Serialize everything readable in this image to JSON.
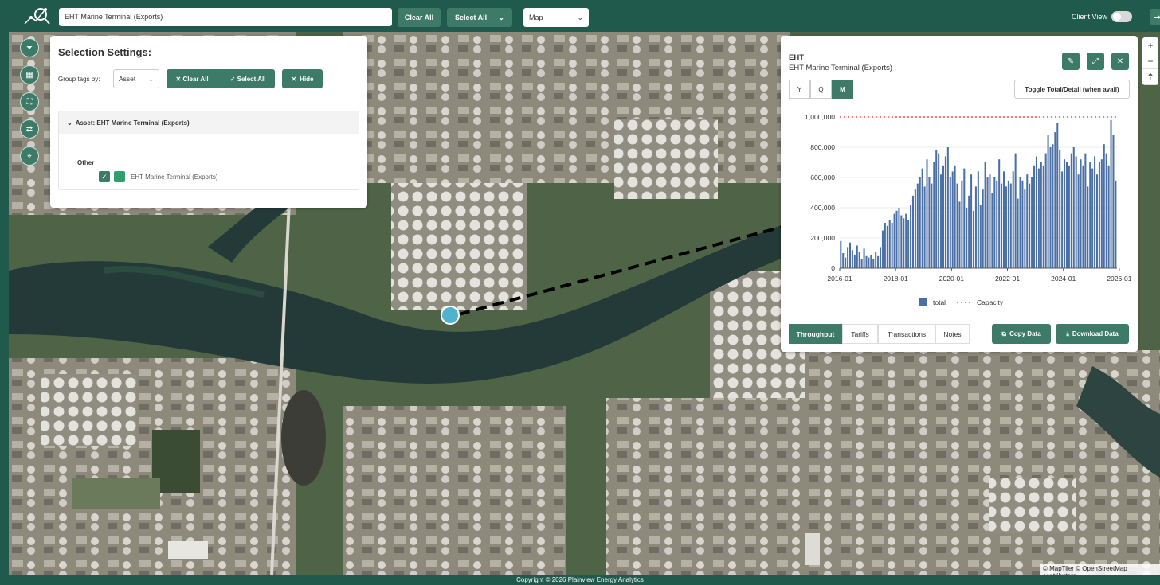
{
  "topbar": {
    "search_value": "EHT Marine Terminal (Exports)",
    "clear_all": "Clear All",
    "select_all": "Select All",
    "view_select": "Map",
    "client_view": "Client View"
  },
  "selection": {
    "title": "Selection Settings:",
    "group_by_label": "Group tags by:",
    "group_by_value": "Asset",
    "clear_all": "Clear All",
    "select_all": "Select All",
    "hide": "Hide",
    "asset_header": "Asset: EHT Marine Terminal (Exports)",
    "group": "Other",
    "item": "EHT Marine Terminal (Exports)"
  },
  "detail": {
    "code": "EHT",
    "name": "EHT Marine Terminal (Exports)",
    "toggle": "Toggle Total/Detail (when avail)",
    "periods": [
      "Y",
      "Q",
      "M"
    ],
    "tabs": [
      "Throughput",
      "Tariffs",
      "Transactions",
      "Notes"
    ],
    "copy": "Copy Data",
    "download": "Download Data"
  },
  "chart_data": {
    "type": "bar",
    "x_ticks": [
      "2016-01",
      "2018-01",
      "2020-01",
      "2022-01",
      "2024-01",
      "2026-01"
    ],
    "y_ticks": [
      "0",
      "200,000",
      "400,000",
      "600,000",
      "800,000",
      "1,000,000"
    ],
    "ylim": [
      0,
      1000000
    ],
    "legend": [
      "total",
      "Capacity"
    ],
    "capacity": 1000000,
    "series": [
      {
        "name": "total",
        "start": "2016-01",
        "values": [
          180000,
          100000,
          70000,
          140000,
          170000,
          120000,
          90000,
          150000,
          110000,
          60000,
          130000,
          80000,
          70000,
          90000,
          60000,
          110000,
          80000,
          140000,
          250000,
          300000,
          280000,
          320000,
          300000,
          360000,
          380000,
          400000,
          350000,
          330000,
          360000,
          320000,
          420000,
          480000,
          520000,
          560000,
          600000,
          660000,
          540000,
          720000,
          600000,
          560000,
          700000,
          780000,
          760000,
          620000,
          680000,
          740000,
          800000,
          600000,
          640000,
          680000,
          560000,
          440000,
          580000,
          660000,
          400000,
          480000,
          620000,
          380000,
          540000,
          640000,
          420000,
          520000,
          700000,
          600000,
          620000,
          500000,
          600000,
          580000,
          720000,
          560000,
          640000,
          540000,
          580000,
          560000,
          640000,
          760000,
          460000,
          600000,
          580000,
          520000,
          620000,
          560000,
          600000,
          680000,
          740000,
          660000,
          700000,
          680000,
          760000,
          880000,
          800000,
          820000,
          900000,
          960000,
          780000,
          640000,
          720000,
          700000,
          680000,
          760000,
          800000,
          740000,
          620000,
          720000,
          680000,
          760000,
          540000,
          700000,
          660000,
          740000,
          620000,
          700000,
          720000,
          820000,
          760000,
          680000,
          980000,
          880000,
          580000
        ]
      }
    ]
  },
  "footer": "Copyright © 2026 Plainview Energy Analytics",
  "attribution": "© MapTiler © OpenStreetMap contributors",
  "map_logo": "maptiler",
  "icons": [
    "filter-icon",
    "map-icon",
    "expand-icon",
    "swap-icon",
    "pin-icon",
    "edit-icon",
    "fullscreen-icon",
    "close-icon",
    "plus-icon",
    "minus-icon",
    "compass-icon"
  ]
}
